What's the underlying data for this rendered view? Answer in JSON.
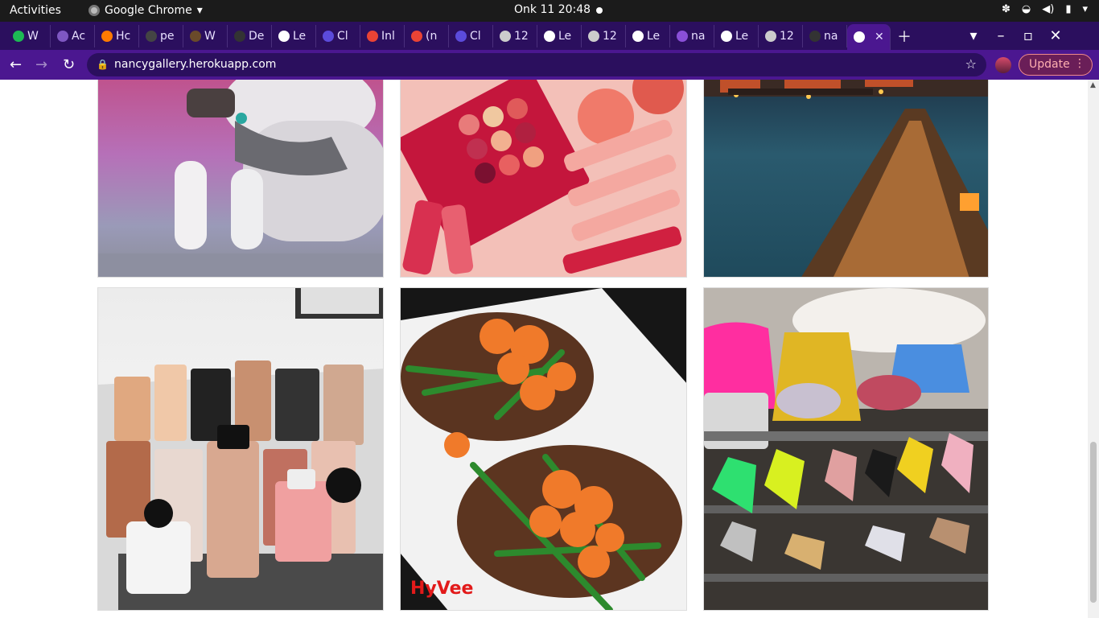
{
  "system": {
    "activities": "Activities",
    "app_name": "Google Chrome",
    "clock": "Onk 11  20:48"
  },
  "tabs": [
    {
      "label": "W",
      "color": "#1db954"
    },
    {
      "label": "Ac",
      "color": "#7e57c2"
    },
    {
      "label": "Hc",
      "color": "#ff7a00"
    },
    {
      "label": "pe",
      "color": "#444444"
    },
    {
      "label": "W",
      "color": "#6a4a2a"
    },
    {
      "label": "De",
      "color": "#333333"
    },
    {
      "label": "Le",
      "color": "#ffffff"
    },
    {
      "label": "Cl",
      "color": "#5b4bdb"
    },
    {
      "label": "Inl",
      "color": "#ea4335"
    },
    {
      "label": "(n",
      "color": "#ea4335"
    },
    {
      "label": "Cl",
      "color": "#5b4bdb"
    },
    {
      "label": "12",
      "color": "#cccccc"
    },
    {
      "label": "Le",
      "color": "#ffffff"
    },
    {
      "label": "12",
      "color": "#cccccc"
    },
    {
      "label": "Le",
      "color": "#ffffff"
    },
    {
      "label": "na",
      "color": "#8a4fd8"
    },
    {
      "label": "Le",
      "color": "#ffffff"
    },
    {
      "label": "12",
      "color": "#cccccc"
    },
    {
      "label": "na",
      "color": "#333333"
    }
  ],
  "toolbar": {
    "url": "nancygallery.herokuapp.com",
    "update_label": "Update"
  },
  "gallery": {
    "images": [
      {
        "subject": "husky dog"
      },
      {
        "subject": "makeup palette and lipsticks"
      },
      {
        "subject": "pier at night over water"
      },
      {
        "subject": "perfume bottles collection"
      },
      {
        "subject": "steak with shrimp and green beans"
      },
      {
        "subject": "designer handbags and shoes shelf"
      }
    ],
    "watermark": "HyVee"
  }
}
